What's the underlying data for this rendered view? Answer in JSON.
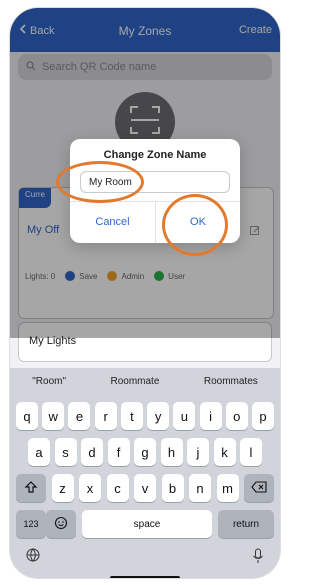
{
  "nav": {
    "back_label": "Back",
    "title": "My Zones",
    "create_label": "Create"
  },
  "search": {
    "placeholder": "Search QR Code name"
  },
  "panel": {
    "tag_label": "Curre",
    "zone_name": "My Off"
  },
  "lights": {
    "label": "Lights: 0",
    "save_label": "Save",
    "admin_label": "Admin",
    "user_label": "User",
    "save_color": "#2f66c9",
    "admin_color": "#f0a22b",
    "user_color": "#27b34a"
  },
  "my_lights_label": "My Lights",
  "modal": {
    "title": "Change Zone Name",
    "field_value": "My Room",
    "cancel_label": "Cancel",
    "ok_label": "OK"
  },
  "keyboard": {
    "suggestions": [
      "\"Room\"",
      "Roommate",
      "Roommates"
    ],
    "row1": [
      "q",
      "w",
      "e",
      "r",
      "t",
      "y",
      "u",
      "i",
      "o",
      "p"
    ],
    "row2": [
      "a",
      "s",
      "d",
      "f",
      "g",
      "h",
      "j",
      "k",
      "l"
    ],
    "row3": [
      "z",
      "x",
      "c",
      "v",
      "b",
      "n",
      "m"
    ],
    "numbers_label": "123",
    "space_label": "space",
    "return_label": "return"
  },
  "colors": {
    "primary": "#2f66c9",
    "highlight": "#e27a2d"
  }
}
